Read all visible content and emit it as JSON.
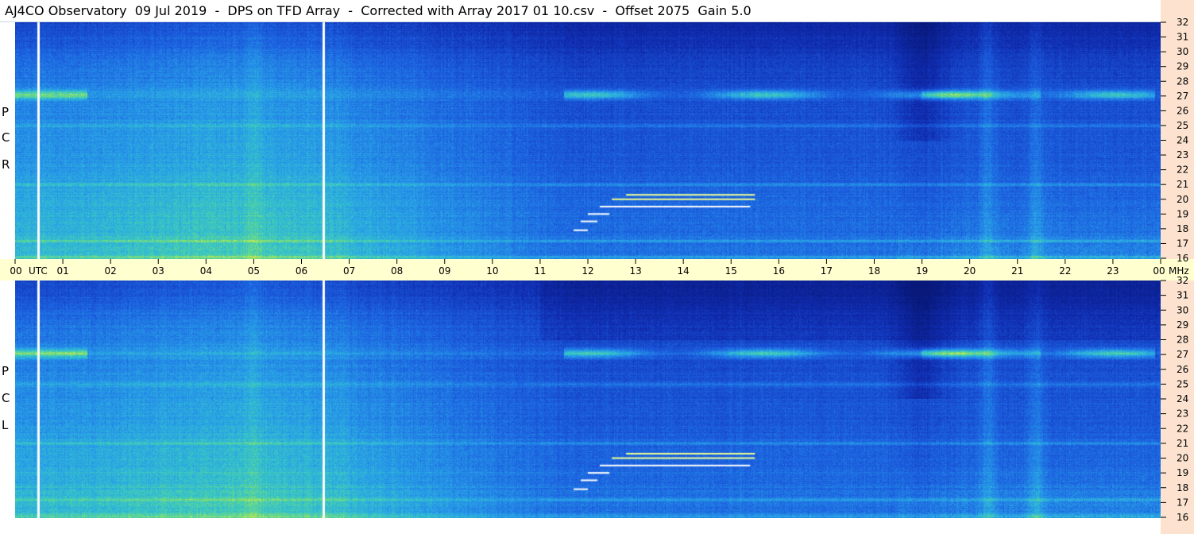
{
  "header": {
    "title": "AJ4CO Observatory  09 Jul 2019  -  DPS on TFD Array  -  Corrected with Array 2017 01 10.csv  -  Offset 2075  Gain 5.0"
  },
  "panels": {
    "rcp": {
      "label_letters": [
        "R",
        "C",
        "P"
      ]
    },
    "lcp": {
      "label_letters": [
        "L",
        "C",
        "P"
      ]
    }
  },
  "colors": {
    "background_low": "#1030b8",
    "background_mid": "#1f74e0",
    "background_high": "#2fb8d8",
    "hot_low": "#46d3a0",
    "hot": "#c8f050",
    "hottest": "#ff4060",
    "time_strip": "#ffffd0",
    "right_strip": "#fde3cf"
  },
  "chart_data": {
    "type": "heatmap",
    "title": "AJ4CO Observatory  09 Jul 2019  -  DPS on TFD Array  -  Corrected with Array 2017 01 10.csv  -  Offset 2075  Gain 5.0",
    "x_axis": {
      "unit_label": "UTC",
      "range_hours": [
        0,
        24
      ],
      "tick_labels": [
        "00",
        "01",
        "02",
        "03",
        "04",
        "05",
        "06",
        "07",
        "08",
        "09",
        "10",
        "11",
        "12",
        "13",
        "14",
        "15",
        "16",
        "17",
        "18",
        "19",
        "20",
        "21",
        "22",
        "23",
        "00"
      ]
    },
    "y_axis": {
      "unit_label": "MHz",
      "range_mhz": [
        16,
        32
      ],
      "tick_labels": [
        "32",
        "31",
        "30",
        "29",
        "28",
        "27",
        "26",
        "25",
        "24",
        "23",
        "22",
        "21",
        "20",
        "19",
        "18",
        "17",
        "16"
      ]
    },
    "series": [
      {
        "name": "RCP",
        "panel": "rcp"
      },
      {
        "name": "LCP",
        "panel": "lcp"
      }
    ],
    "markers_utc_hours": [
      0.48,
      6.45
    ],
    "features": {
      "persistent_bands_mhz": [
        27.1,
        25.0,
        21.0,
        17.2,
        16.1
      ],
      "daytime_high_band_range_utc": [
        11.5,
        23.9
      ],
      "stepped_signal_mhz": [
        17.9,
        18.5,
        19.0,
        19.5,
        20.0,
        20.3
      ],
      "stepped_signal_utc_start": [
        11.7,
        11.85,
        12.0,
        12.25,
        12.5,
        12.8
      ],
      "stepped_signal_utc_end": [
        12.0,
        12.2,
        12.45,
        15.4,
        15.5,
        15.5
      ],
      "quiet_region_utc": [
        18.4,
        19.6
      ],
      "vertical_bright_columns_utc": [
        5.0,
        20.4,
        21.4
      ]
    }
  }
}
